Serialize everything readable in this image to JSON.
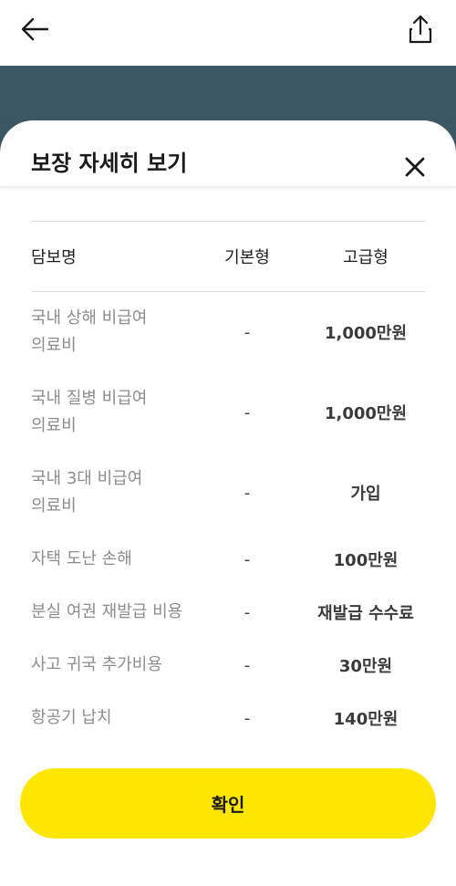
{
  "header": {
    "back_icon": "arrow-left-icon",
    "share_icon": "share-icon"
  },
  "colors": {
    "backdrop": "#3b5762",
    "accent_button": "#ffe600"
  },
  "sheet": {
    "title": "보장 자세히 보기",
    "close_icon": "close-icon"
  },
  "table": {
    "columns": [
      "담보명",
      "기본형",
      "고급형"
    ],
    "rows": [
      {
        "name": "국내 상해 비급여\n의료비",
        "basic": "-",
        "premium": "1,000만원"
      },
      {
        "name": "국내 질병 비급여\n의료비",
        "basic": "-",
        "premium": "1,000만원"
      },
      {
        "name": "국내 3대 비급여\n의료비",
        "basic": "-",
        "premium": "가입"
      },
      {
        "name": "자택 도난 손해",
        "basic": "-",
        "premium": "100만원"
      },
      {
        "name": "분실 여권 재발급 비용",
        "basic": "-",
        "premium": "재발급 수수료"
      },
      {
        "name": "사고 귀국 추가비용",
        "basic": "-",
        "premium": "30만원"
      },
      {
        "name": "항공기 납치",
        "basic": "-",
        "premium": "140만원"
      }
    ]
  },
  "confirm_label": "확인"
}
